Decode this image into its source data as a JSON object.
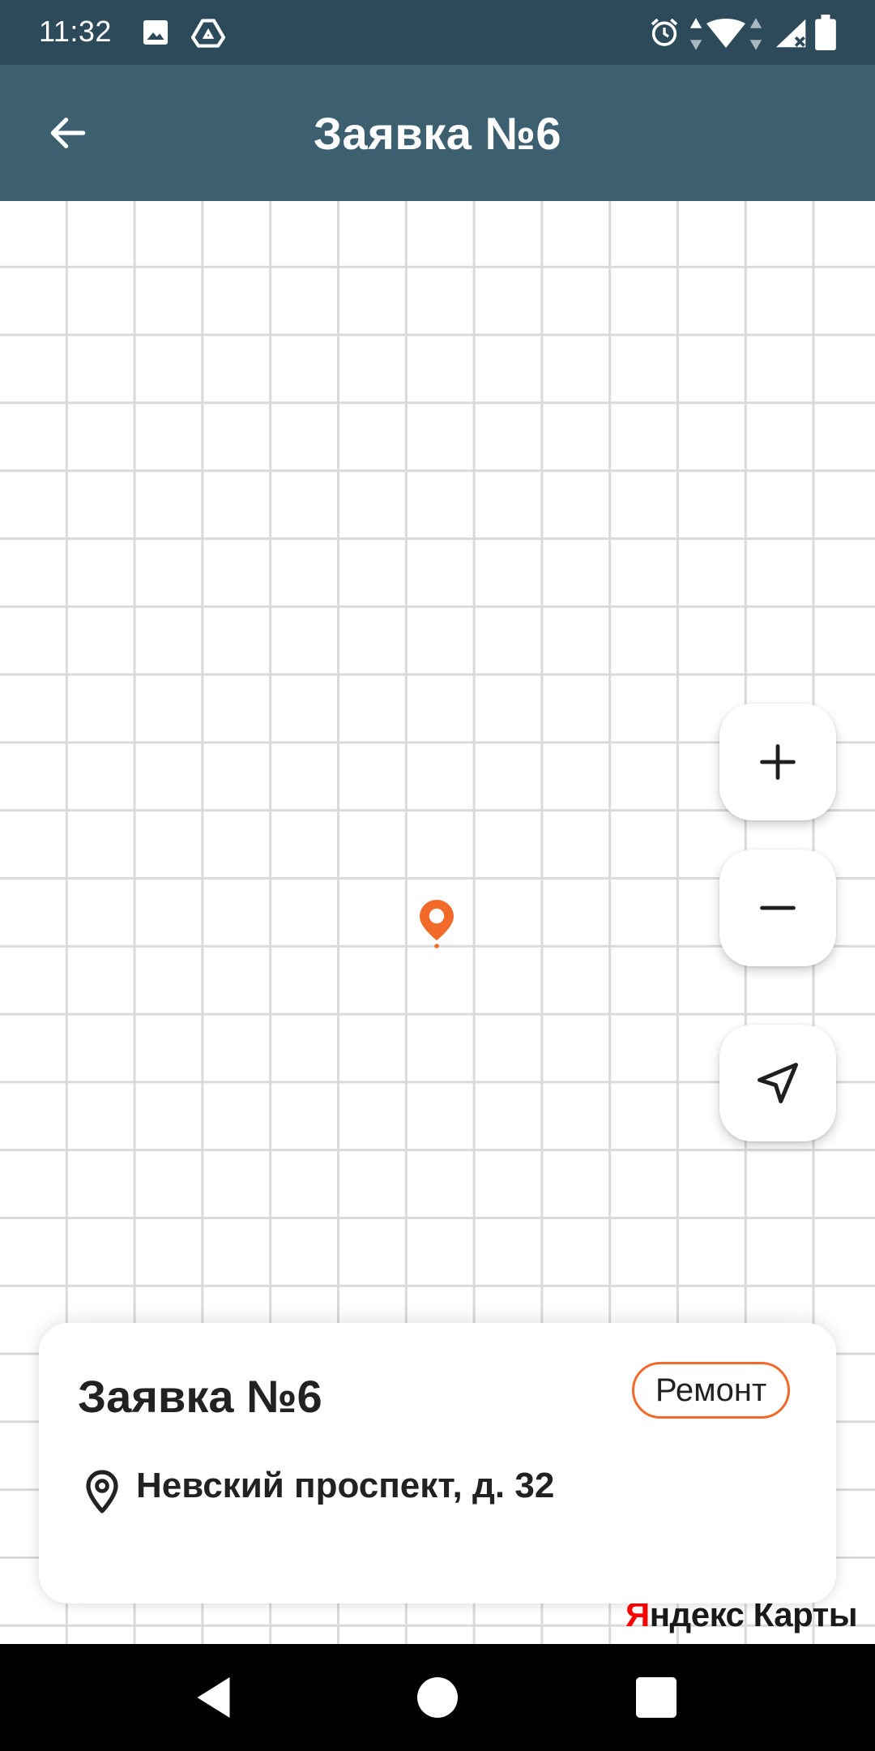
{
  "status_bar": {
    "time": "11:32",
    "left_icons": [
      "image-icon",
      "drive-icon"
    ],
    "right_icons": [
      "alarm-icon",
      "data-arrows-icon",
      "wifi-icon",
      "signal-icon",
      "battery-icon"
    ]
  },
  "app_bar": {
    "title": "Заявка №6",
    "back_icon": "arrow-back-icon"
  },
  "map": {
    "marker_icon": "map-pin-icon",
    "marker_color": "#f26a2a",
    "controls": [
      {
        "name": "zoom-in",
        "icon": "plus-icon"
      },
      {
        "name": "zoom-out",
        "icon": "minus-icon"
      },
      {
        "name": "my-location",
        "icon": "navigation-arrow-icon"
      }
    ],
    "attribution_first": "Я",
    "attribution_rest": "ндекс Карты"
  },
  "card": {
    "title": "Заявка №6",
    "badge": "Ремонт",
    "badge_color": "#f26a2a",
    "address": "Невский проспект, д. 32",
    "address_icon": "location-pin-outline-icon"
  },
  "nav_bar": {
    "buttons": [
      "back-triangle-icon",
      "home-circle-icon",
      "recents-square-icon"
    ]
  },
  "colors": {
    "status_bar": "#2d4a5a",
    "app_bar": "#3d6070",
    "accent": "#f26a2a"
  }
}
